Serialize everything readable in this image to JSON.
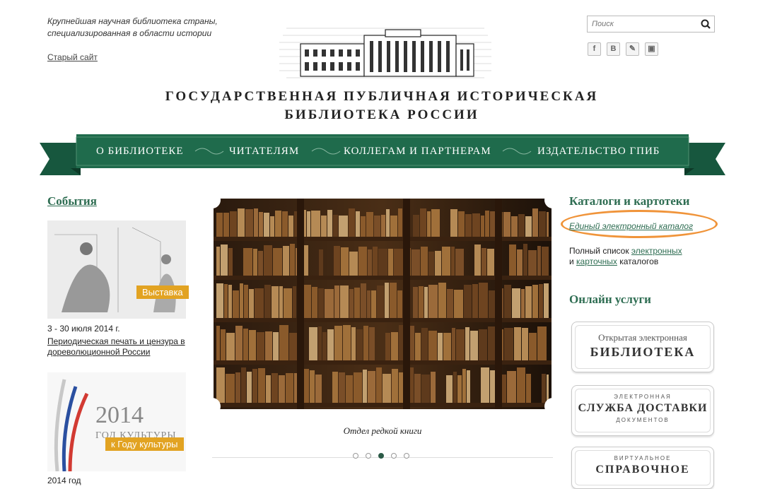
{
  "header": {
    "tagline": "Крупнейшая научная библиотека страны, специализированная в области истории",
    "old_site": "Старый сайт",
    "title_line1": "ГОСУДАРСТВЕННАЯ ПУБЛИЧНАЯ ИСТОРИЧЕСКАЯ",
    "title_line2": "БИБЛИОТЕКА РОССИИ",
    "search_placeholder": "Поиск"
  },
  "social": [
    {
      "icon": "facebook-icon",
      "glyph": "f"
    },
    {
      "icon": "vkontakte-icon",
      "glyph": "B"
    },
    {
      "icon": "livejournal-icon",
      "glyph": "✎"
    },
    {
      "icon": "rss-icon",
      "glyph": "▣"
    }
  ],
  "nav": [
    "О БИБЛИОТЕКЕ",
    "ЧИТАТЕЛЯМ",
    "КОЛЛЕГАМ И ПАРТНЕРАМ",
    "ИЗДАТЕЛЬСТВО ГПИБ"
  ],
  "events": {
    "heading": "События",
    "items": [
      {
        "badge": "Выставка",
        "date": "3 - 30 июля 2014 г.",
        "title": "Периодическая печать и цензура в дореволюционной России"
      },
      {
        "badge": "к Году культуры",
        "year_text": "2014",
        "sub_text": "ГОД КУЛЬТУРЫ",
        "date": "2014 год"
      }
    ]
  },
  "slider": {
    "caption": "Отдел редкой книги",
    "dot_count": 5,
    "active_dot": 3
  },
  "catalogs": {
    "heading": "Каталоги и картотеки",
    "main_link": "Единый электронный каталог",
    "text_before": "Полный список ",
    "link_electronic": "электронных",
    "text_and": "и ",
    "link_card": "карточных",
    "text_after": " каталогов"
  },
  "services": {
    "heading": "Онлайн услуги",
    "cards": [
      {
        "small": "Открытая электронная",
        "big": "БИБЛИОТЕКА"
      },
      {
        "top": "ЭЛЕКТРОННАЯ",
        "big": "СЛУЖБА ДОСТАВКИ",
        "bottom": "ДОКУМЕНТОВ"
      },
      {
        "top": "ВИРТУАЛЬНОЕ",
        "big": "СПРАВОЧНОЕ"
      }
    ]
  },
  "colors": {
    "nav_green": "#1f6b4c",
    "heading_green": "#2e6d52",
    "badge_orange": "#e2a322",
    "highlight_orange": "#f0943a"
  }
}
